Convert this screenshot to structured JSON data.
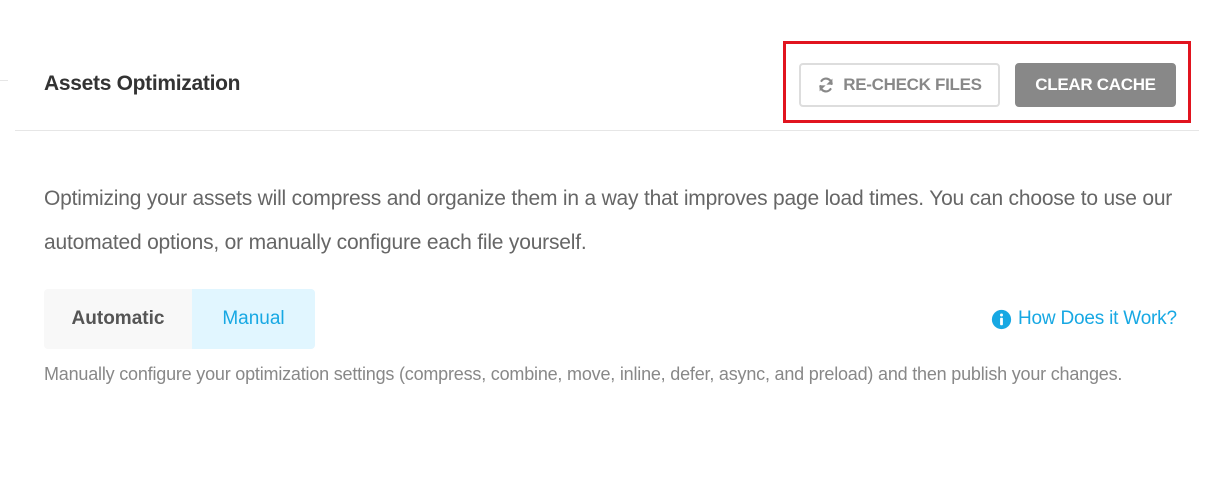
{
  "header": {
    "title": "Assets Optimization",
    "recheck_label": "RE-CHECK FILES",
    "recheck_icon": "refresh-icon",
    "clear_cache_label": "CLEAR CACHE"
  },
  "main": {
    "description": "Optimizing your assets will compress and organize them in a way that improves page load times. You can choose to use our automated options, or manually configure each file yourself.",
    "tabs": [
      {
        "label": "Automatic",
        "active": false
      },
      {
        "label": "Manual",
        "active": true
      }
    ],
    "help_link": {
      "label": "How Does it Work?",
      "icon": "info-icon"
    },
    "tab_description": "Manually configure your optimization settings (compress, combine, move, inline, defer, async, and preload) and then publish your changes."
  },
  "colors": {
    "accent": "#17a8e3",
    "highlight": "#e1141f",
    "button_gray": "#888888",
    "active_tab_bg": "#e1f6ff"
  }
}
